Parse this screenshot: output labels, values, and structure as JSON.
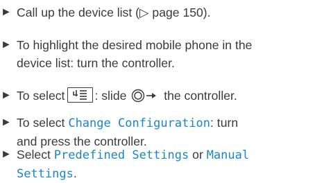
{
  "steps": [
    {
      "bullet": "►",
      "text": "Call up the device list (▷ page 150)."
    },
    {
      "bullet": "►",
      "line1": "To highlight the desired mobile phone in the",
      "line2": "device list: turn the controller."
    },
    {
      "bullet": "►",
      "before": "To select",
      "softkey_icon": "menu-list-icon",
      "middle": ": slide",
      "controller_icon": "controller-slide-right-icon",
      "after": "the controller."
    },
    {
      "bullet": "►",
      "before": "To select ",
      "code": "Change Configuration",
      "after": ": turn",
      "line2": "and press the controller."
    },
    {
      "bullet": "►",
      "before": "Select ",
      "code1": "Predefined Settings",
      "mid": " or ",
      "code2a": "Manual",
      "code2b": "Settings",
      "after": "."
    }
  ],
  "colors": {
    "text": "#3a3a3a",
    "code": "#1a86c9"
  }
}
